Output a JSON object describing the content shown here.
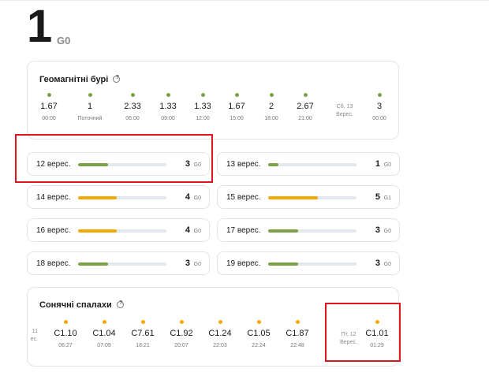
{
  "current": {
    "kp": "1",
    "level": "G0"
  },
  "storms": {
    "title": "Геомагнітні бурі",
    "forecast": [
      {
        "value": "1.67",
        "time": "00:00",
        "color": "#7ba247"
      },
      {
        "value": "1",
        "time": "Поточний",
        "color": "#7ba247"
      },
      {
        "value": "2.33",
        "time": "06:00",
        "color": "#7ba247"
      },
      {
        "value": "1.33",
        "time": "09:00",
        "color": "#7ba247"
      },
      {
        "value": "1.33",
        "time": "12:00",
        "color": "#7ba247"
      },
      {
        "value": "1.67",
        "time": "15:00",
        "color": "#7ba247"
      },
      {
        "value": "2",
        "time": "18:00",
        "color": "#7ba247"
      },
      {
        "value": "2.67",
        "time": "21:00",
        "color": "#7ba247"
      },
      {
        "value": "3",
        "time": "00:00",
        "color": "#7ba247"
      }
    ],
    "day_marker": {
      "line1": "Сб, 13",
      "line2": "Верес."
    }
  },
  "days": [
    {
      "label": "12 верес.",
      "kp": "3",
      "g": "G0",
      "fill": 0.34,
      "color": "#7ba247"
    },
    {
      "label": "13 верес.",
      "kp": "1",
      "g": "G0",
      "fill": 0.12,
      "color": "#7ba247"
    },
    {
      "label": "14 верес.",
      "kp": "4",
      "g": "G0",
      "fill": 0.44,
      "color": "#f5a800"
    },
    {
      "label": "15 верес.",
      "kp": "5",
      "g": "G1",
      "fill": 0.56,
      "color": "#f5a800"
    },
    {
      "label": "16 верес.",
      "kp": "4",
      "g": "G0",
      "fill": 0.44,
      "color": "#f5a800"
    },
    {
      "label": "17 верес.",
      "kp": "3",
      "g": "G0",
      "fill": 0.34,
      "color": "#7ba247"
    },
    {
      "label": "18 верес.",
      "kp": "3",
      "g": "G0",
      "fill": 0.34,
      "color": "#7ba247"
    },
    {
      "label": "19 верес.",
      "kp": "3",
      "g": "G0",
      "fill": 0.34,
      "color": "#7ba247"
    }
  ],
  "flares": {
    "title": "Сонячні спалахи",
    "prev_day": {
      "line1": "11",
      "line2": "ес."
    },
    "items": [
      {
        "value": "C1.10",
        "time": "06:27",
        "color": "#f5a800"
      },
      {
        "value": "C1.04",
        "time": "07:09",
        "color": "#f5a800"
      },
      {
        "value": "C7.61",
        "time": "18:21",
        "color": "#f5a800"
      },
      {
        "value": "C1.92",
        "time": "20:07",
        "color": "#f5a800"
      },
      {
        "value": "C1.24",
        "time": "22:03",
        "color": "#f5a800"
      },
      {
        "value": "C1.05",
        "time": "22:24",
        "color": "#f5a800"
      },
      {
        "value": "C1.87",
        "time": "22:48",
        "color": "#f5a800"
      },
      {
        "value": "C1.01",
        "time": "01:29",
        "color": "#f5a800"
      }
    ],
    "day_marker": {
      "line1": "Пт, 12",
      "line2": "Верес."
    }
  },
  "highlight_color": "#e0141e"
}
